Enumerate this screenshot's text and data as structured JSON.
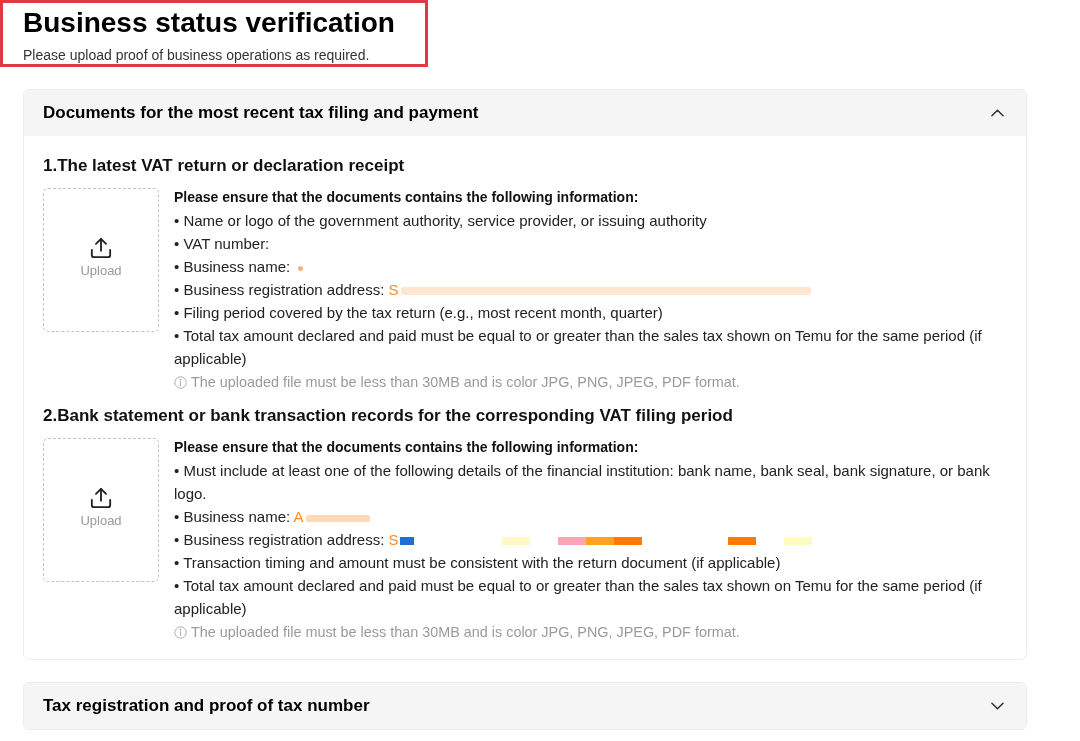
{
  "header": {
    "title": "Business status verification",
    "subtitle": "Please upload proof of business operations as required.",
    "highlighted": true
  },
  "panels": [
    {
      "title": "Documents for the most recent tax filing and payment",
      "expanded": true,
      "sections": [
        {
          "title": "1.The latest VAT return or declaration receipt",
          "upload_label": "Upload",
          "requirements_heading": "Please ensure that the documents contains the following information:",
          "items": [
            {
              "kind": "plain",
              "text": "• Name or logo of the government authority, service provider, or issuing authority"
            },
            {
              "kind": "plain",
              "text": "• VAT number:"
            },
            {
              "kind": "dot",
              "text": "• Business name:"
            },
            {
              "kind": "smear",
              "text": "• Business registration address:",
              "value": "S"
            },
            {
              "kind": "plain",
              "text": "• Filing period covered by the tax return (e.g., most recent month, quarter)"
            },
            {
              "kind": "plain",
              "text": "• Total tax amount declared and paid must be equal to or greater than the sales tax shown on Temu for the same period (if applicable)"
            }
          ],
          "note": "The uploaded file must be less than 30MB and is color JPG, PNG, JPEG, PDF format."
        },
        {
          "title": "2.Bank statement or bank transaction records for the corresponding VAT filing period",
          "upload_label": "Upload",
          "requirements_heading": "Please ensure that the documents contains the following information:",
          "items": [
            {
              "kind": "plain",
              "text": "• Must include at least one of the following details of the financial institution: bank name, bank seal, bank signature, or bank logo."
            },
            {
              "kind": "blur",
              "text": "• Business name:",
              "value": "A"
            },
            {
              "kind": "mosaic",
              "text": "• Business registration address:",
              "value": "S"
            },
            {
              "kind": "plain",
              "text": "• Transaction timing and amount must be consistent with the return document (if applicable)"
            },
            {
              "kind": "plain",
              "text": "• Total tax amount declared and paid must be equal to or greater than the sales tax shown on Temu for the same period (if applicable)"
            }
          ],
          "note": "The uploaded file must be less than 30MB and is color JPG, PNG, JPEG, PDF format."
        }
      ]
    },
    {
      "title": "Tax registration and proof of tax number",
      "expanded": false
    }
  ]
}
